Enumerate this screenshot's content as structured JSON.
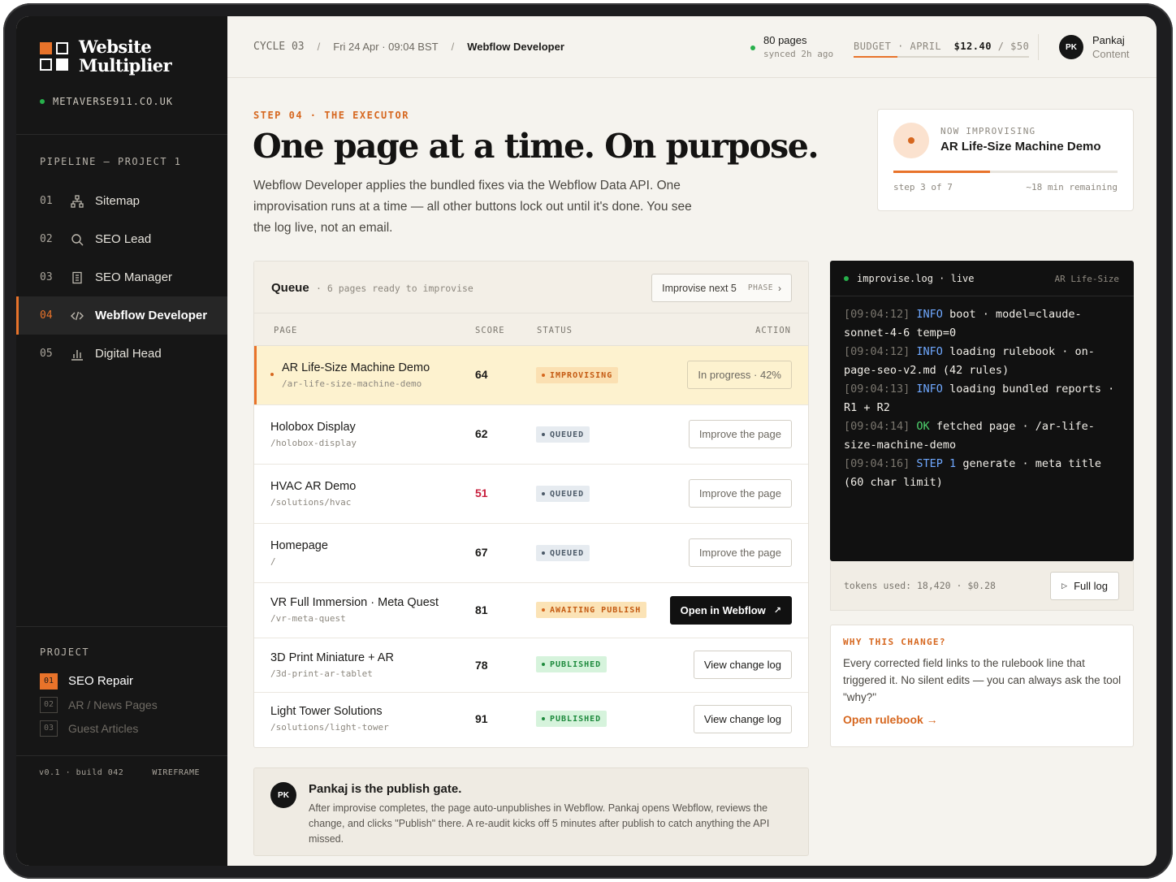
{
  "brand": {
    "name_line1": "Website",
    "name_line2": "Multiplier",
    "domain": "METAVERSE911.CO.UK"
  },
  "sidebar": {
    "pipeline_label": "PIPELINE — PROJECT 1",
    "items": [
      {
        "num": "01",
        "label": "Sitemap",
        "icon": "sitemap-icon"
      },
      {
        "num": "02",
        "label": "SEO Lead",
        "icon": "search-icon"
      },
      {
        "num": "03",
        "label": "SEO Manager",
        "icon": "clipboard-icon"
      },
      {
        "num": "04",
        "label": "Webflow Developer",
        "icon": "code-icon",
        "active": true
      },
      {
        "num": "05",
        "label": "Digital Head",
        "icon": "bar-chart-icon"
      }
    ],
    "project_label": "PROJECT",
    "projects": [
      {
        "num": "01",
        "label": "SEO Repair",
        "active": true
      },
      {
        "num": "02",
        "label": "AR / News Pages"
      },
      {
        "num": "03",
        "label": "Guest Articles"
      }
    ],
    "version": "v0.1 · build 042",
    "mode": "WIREFRAME"
  },
  "topbar": {
    "cycle": "CYCLE 03",
    "datetime": "Fri 24 Apr · 09:04 BST",
    "current": "Webflow Developer",
    "sync_pages": "80 pages",
    "sync_time": "synced 2h ago",
    "budget_label": "BUDGET · APRIL",
    "budget_spent": "$12.40",
    "budget_total": "/ $50",
    "budget_used_fraction": 0.248,
    "user_initials": "PK",
    "user_name": "Pankaj",
    "user_role": "Content"
  },
  "hero": {
    "step": "STEP 04 · THE EXECUTOR",
    "title": "One page at a time. On purpose.",
    "lede": "Webflow Developer applies the bundled fixes via the Webflow Data API. One improvisation runs at a time — all other buttons lock out until it's done. You see the log live, not an email."
  },
  "now": {
    "label": "NOW IMPROVISING",
    "page": "AR Life-Size Machine Demo",
    "step_text": "step 3 of 7",
    "remaining": "~18 min remaining",
    "progress": 0.43
  },
  "queue": {
    "title": "Queue",
    "subtitle": "· 6 pages ready to improvise",
    "button": "Improvise next 5",
    "button_tag": "PHASE",
    "columns": {
      "page": "PAGE",
      "score": "SCORE",
      "status": "STATUS",
      "action": "ACTION"
    },
    "rows": [
      {
        "name": "AR Life-Size Machine Demo",
        "path": "/ar-life-size-machine-demo",
        "score": "64",
        "status": "IMPROVISING",
        "action": "In progress · 42%"
      },
      {
        "name": "Holobox Display",
        "path": "/holobox-display",
        "score": "62",
        "status": "QUEUED",
        "action": "Improve the page"
      },
      {
        "name": "HVAC AR Demo",
        "path": "/solutions/hvac",
        "score": "51",
        "status": "QUEUED",
        "action": "Improve the page"
      },
      {
        "name": "Homepage",
        "path": "/",
        "score": "67",
        "status": "QUEUED",
        "action": "Improve the page"
      },
      {
        "name": "VR Full Immersion · Meta Quest",
        "path": "/vr-meta-quest",
        "score": "81",
        "status": "AWAITING PUBLISH",
        "action": "Open in Webflow"
      },
      {
        "name": "3D Print Miniature + AR",
        "path": "/3d-print-ar-tablet",
        "score": "78",
        "status": "PUBLISHED",
        "action": "View change log"
      },
      {
        "name": "Light Tower Solutions",
        "path": "/solutions/light-tower",
        "score": "91",
        "status": "PUBLISHED",
        "action": "View change log"
      }
    ]
  },
  "log": {
    "title": "improvise.log · live",
    "context": "AR Life-Size",
    "lines": [
      {
        "ts": "[09:04:12]",
        "level": "INFO",
        "msg": "boot · model=claude-sonnet-4-6 temp=0"
      },
      {
        "ts": "[09:04:12]",
        "level": "INFO",
        "msg": "loading rulebook · on-page-seo-v2.md (42 rules)"
      },
      {
        "ts": "[09:04:13]",
        "level": "INFO",
        "msg": "loading bundled reports · R1 + R2"
      },
      {
        "ts": "[09:04:14]",
        "level": "OK",
        "msg": "fetched page · /ar-life-size-machine-demo"
      },
      {
        "ts": "[09:04:16]",
        "level": "STEP 1",
        "msg": "generate · meta title (60 char limit)"
      }
    ],
    "tokens": "tokens used: 18,420 · $0.28",
    "full_log": "Full log"
  },
  "why": {
    "title": "WHY THIS CHANGE?",
    "text": "Every corrected field links to the rulebook line that triggered it. No silent edits — you can always ask the tool \"why?\"",
    "link": "Open rulebook →"
  },
  "gate": {
    "initials": "PK",
    "title": "Pankaj is the publish gate.",
    "text": "After improvise completes, the page auto-unpublishes in Webflow. Pankaj opens Webflow, reviews the change, and clicks \"Publish\" there. A re-audit kicks off 5 minutes after publish to catch anything the API missed."
  },
  "colors": {
    "accent": "#e8732a",
    "sidebar": "#161616",
    "canvas": "#f5f3ee",
    "published": "#1e8a3d",
    "low_score": "#c8203e"
  }
}
